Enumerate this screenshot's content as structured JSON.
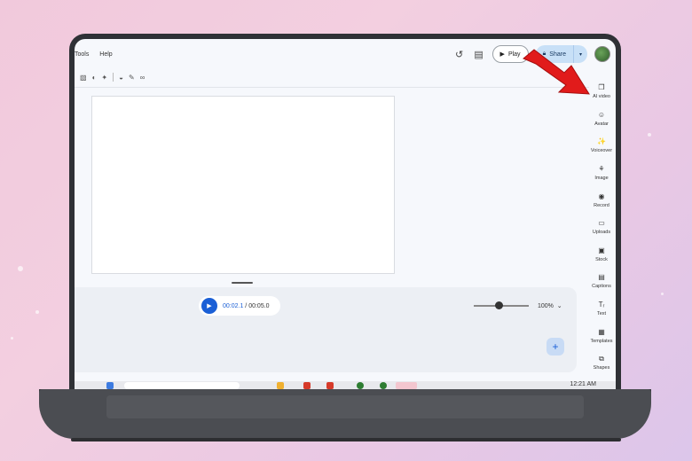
{
  "menu": {
    "tools": "Tools",
    "help": "Help"
  },
  "header": {
    "play_label": "Play",
    "share_label": "Share"
  },
  "timeline": {
    "current_time": "00:02.1",
    "separator": " / ",
    "total_time": "00:05.0",
    "zoom": "100%",
    "zoom_level_fraction": 0.45
  },
  "sidebar": {
    "items": [
      {
        "label": "AI video",
        "icon": "ai-video-icon"
      },
      {
        "label": "Avatar",
        "icon": "avatar-icon"
      },
      {
        "label": "Voiceover",
        "icon": "voiceover-icon"
      },
      {
        "label": "Image",
        "icon": "image-icon"
      },
      {
        "label": "Record",
        "icon": "record-icon"
      },
      {
        "label": "Uploads",
        "icon": "uploads-icon"
      },
      {
        "label": "Stock",
        "icon": "stock-icon"
      },
      {
        "label": "Captions",
        "icon": "captions-icon"
      },
      {
        "label": "Text",
        "icon": "text-icon"
      },
      {
        "label": "Templates",
        "icon": "templates-icon"
      },
      {
        "label": "Shapes",
        "icon": "shapes-icon"
      }
    ]
  },
  "taskbar": {
    "clock": "12:21 AM"
  },
  "colors": {
    "accent": "#1a5fd6",
    "share_bg": "#c8e0f7",
    "annotation_arrow": "#e11b1b"
  }
}
